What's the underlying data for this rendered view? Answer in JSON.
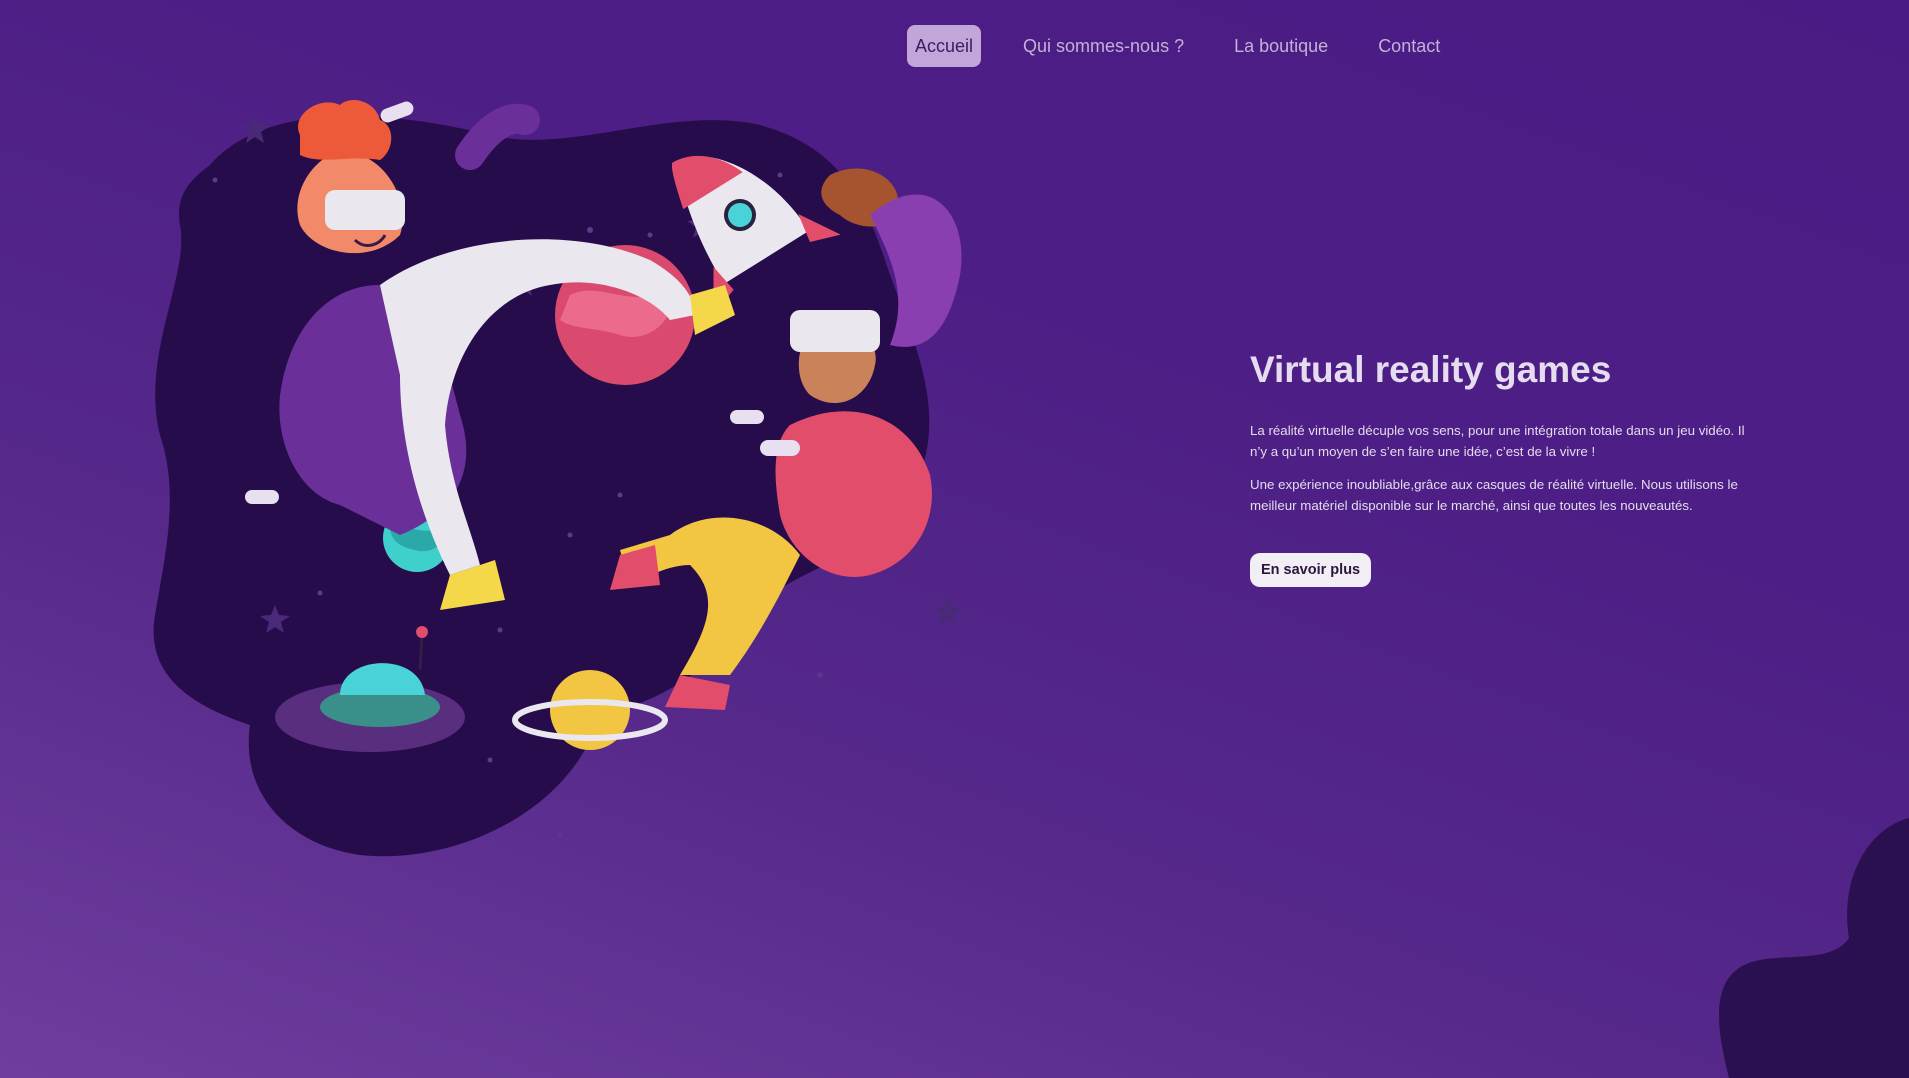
{
  "nav": {
    "items": [
      {
        "label": "Accueil",
        "active": true
      },
      {
        "label": "Qui sommes-nous ?",
        "active": false
      },
      {
        "label": "La boutique",
        "active": false
      },
      {
        "label": "Contact",
        "active": false
      }
    ]
  },
  "hero": {
    "title": "Virtual reality games",
    "paragraph1": "La réalité virtuelle décuple vos sens, pour une intégration totale dans un jeu vidéo. Il n’y a qu’un moyen de s’en faire une idée, c’est de la vivre !",
    "paragraph2": "Une expérience inoubliable,grâce aux casques de réalité virtuelle. Nous utilisons le meilleur matériel disponible sur le marché, ainsi que toutes les nouveautés.",
    "cta_label": "En savoir plus"
  },
  "colors": {
    "background": "#4d1f86",
    "blob": "#2a1050",
    "accent_active": "#c1a7d9"
  },
  "icons": [
    "vr-illustration",
    "rocket-icon",
    "planet-icon",
    "ufo-icon"
  ]
}
